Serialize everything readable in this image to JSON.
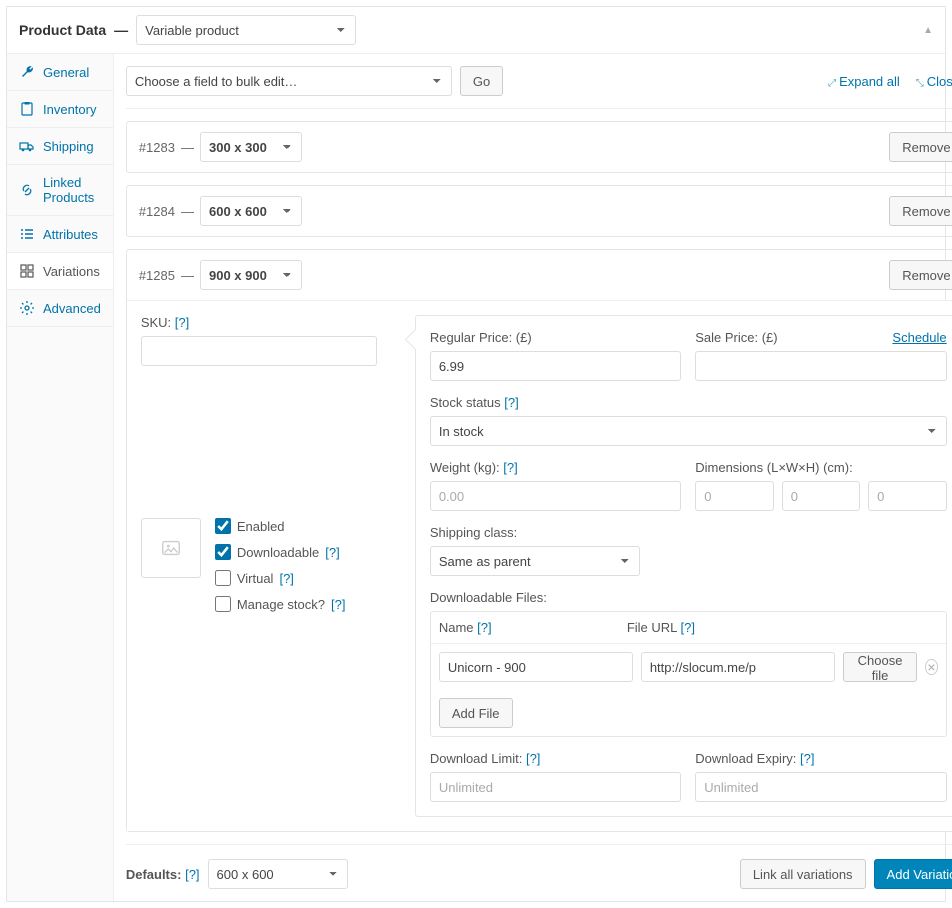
{
  "header": {
    "title": "Product Data",
    "product_type": "Variable product"
  },
  "sidebar": {
    "items": [
      {
        "key": "general",
        "label": "General"
      },
      {
        "key": "inventory",
        "label": "Inventory"
      },
      {
        "key": "shipping",
        "label": "Shipping"
      },
      {
        "key": "linked",
        "label": "Linked Products"
      },
      {
        "key": "attributes",
        "label": "Attributes"
      },
      {
        "key": "variations",
        "label": "Variations"
      },
      {
        "key": "advanced",
        "label": "Advanced"
      }
    ]
  },
  "toolbar": {
    "bulk_placeholder": "Choose a field to bulk edit…",
    "go_label": "Go",
    "expand_all": "Expand all",
    "close_all": "Close all"
  },
  "variations": [
    {
      "id": "#1283",
      "dash": "—",
      "size": "300 x 300",
      "remove": "Remove"
    },
    {
      "id": "#1284",
      "dash": "—",
      "size": "600 x 600",
      "remove": "Remove"
    },
    {
      "id": "#1285",
      "dash": "—",
      "size": "900 x 900",
      "remove": "Remove"
    }
  ],
  "detail": {
    "sku_label": "SKU:",
    "sku_value": "",
    "enabled_label": "Enabled",
    "downloadable_label": "Downloadable",
    "virtual_label": "Virtual",
    "manage_stock_label": "Manage stock?",
    "regular_price_label": "Regular Price: (£)",
    "regular_price_value": "6.99",
    "sale_price_label": "Sale Price: (£)",
    "sale_price_value": "",
    "schedule_label": "Schedule",
    "stock_status_label": "Stock status",
    "stock_status_value": "In stock",
    "weight_label": "Weight (kg):",
    "weight_placeholder": "0.00",
    "dimensions_label": "Dimensions (L×W×H) (cm):",
    "dim_placeholder": "0",
    "shipping_class_label": "Shipping class:",
    "shipping_class_value": "Same as parent",
    "files_label": "Downloadable Files:",
    "file_name_header": "Name",
    "file_url_header": "File URL",
    "file_name_value": "Unicorn - 900",
    "file_url_value": "http://slocum.me/p",
    "choose_file_label": "Choose file",
    "add_file_label": "Add File",
    "download_limit_label": "Download Limit:",
    "download_expiry_label": "Download Expiry:",
    "unlimited_placeholder": "Unlimited",
    "help": "[?]"
  },
  "footer": {
    "defaults_label": "Defaults:",
    "defaults_value": "600 x 600",
    "link_all_label": "Link all variations",
    "add_variation_label": "Add Variation"
  }
}
